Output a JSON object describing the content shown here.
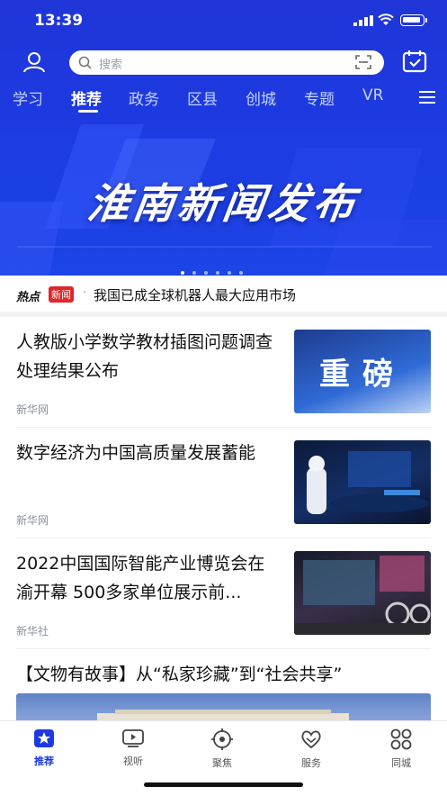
{
  "status": {
    "time": "13:39"
  },
  "search": {
    "placeholder": "搜索"
  },
  "tabs": [
    "学习",
    "推荐",
    "政务",
    "区县",
    "创城",
    "专题",
    "VR"
  ],
  "banner": {
    "title": "淮南新闻发布",
    "dots": 6,
    "active_dot": 0
  },
  "hot_news": {
    "logo": "热点",
    "tag": "新闻",
    "text": "我国已成全球机器人最大应用市场"
  },
  "articles": [
    {
      "title": "人教版小学数学教材插图问题调查处理结果公布",
      "source": "新华网",
      "thumb_text": "重磅"
    },
    {
      "title": "数字经济为中国高质量发展蓄能",
      "source": "新华网"
    },
    {
      "title": "2022中国国际智能产业博览会在渝开幕 500多家单位展示前...",
      "source": "新华社"
    }
  ],
  "feature": {
    "title": "【文物有故事】从“私家珍藏”到“社会共享”"
  },
  "tabbar": [
    {
      "label": "推荐",
      "icon": "star-icon",
      "active": true
    },
    {
      "label": "视听",
      "icon": "play-icon"
    },
    {
      "label": "聚焦",
      "icon": "target-icon"
    },
    {
      "label": "服务",
      "icon": "heart-icon"
    },
    {
      "label": "同城",
      "icon": "grid-icon"
    }
  ],
  "colors": {
    "brand": "#1d3ae0",
    "hot_tag": "#e0262b"
  }
}
